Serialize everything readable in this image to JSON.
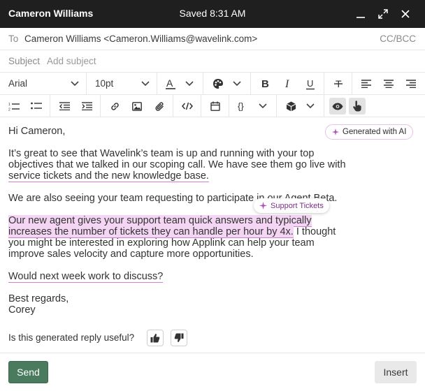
{
  "titlebar": {
    "name": "Cameron Williams",
    "saved": "Saved 8:31 AM"
  },
  "to": {
    "label": "To",
    "value": "Cameron Williams <Cameron.Williams@wavelink.com>",
    "ccbcc": "CC/BCC"
  },
  "subject": {
    "label": "Subject",
    "placeholder": "Add subject"
  },
  "toolbar": {
    "font": "Arial",
    "size": "10pt"
  },
  "ai_badge": "Generated with AI",
  "chip": "Support Tickets",
  "email": {
    "greeting": "Hi Cameron,",
    "p1_plain": "It’s great to see that Wavelink’s team is up and running with your top objectives that we talked in our scoping call. We have see them go live with ",
    "p1_hl": "service tickets and the new knowledge base.",
    "p2": "We are also seeing your team requesting to participate in our Agent Beta.",
    "p3_hl": "Our new agent gives your support team quick answers and typically increases the number of tickets they can handle per hour by 4x.",
    "p3_plain": " I thought you might be interested in exploring how Applink can help your team improve sales velocity and capture more opportunities.",
    "p4_hl": "Would next week work to discuss?",
    "sign1": "Best regards,",
    "sign2": "Corey"
  },
  "feedback": {
    "question": "Is this generated reply useful?"
  },
  "footer": {
    "send": "Send",
    "insert": "Insert"
  },
  "colors": {
    "send_bg": "#4a7b5e",
    "highlight": "#f4d6f4",
    "titlebar": "#1f1f1f"
  }
}
